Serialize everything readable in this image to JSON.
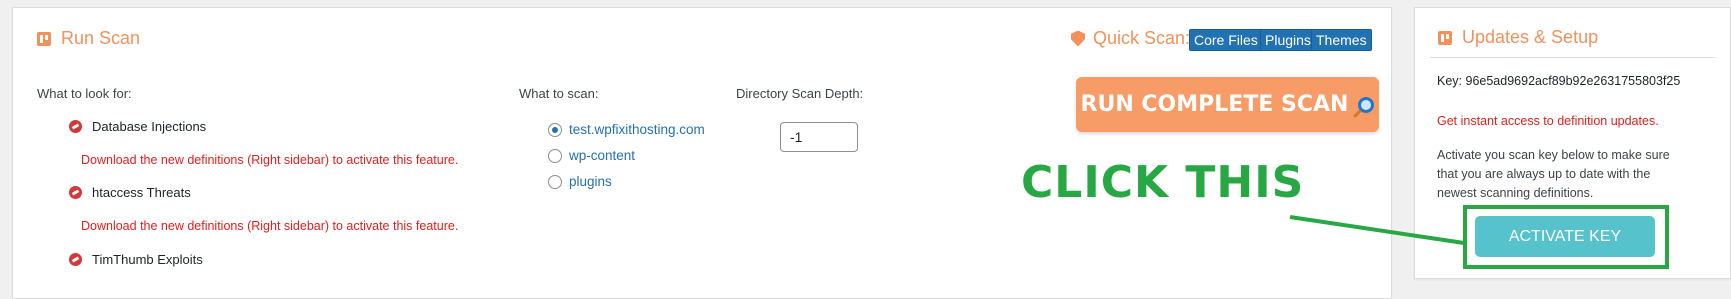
{
  "scan": {
    "title": "Run Scan",
    "quick_scan_label": "Quick Scan:",
    "quick_buttons": [
      "Core Files",
      "Plugins",
      "Themes"
    ],
    "look_for_label": "What to look for:",
    "threats": [
      {
        "name": "Database Injections",
        "warning": "Download the new definitions (Right sidebar) to activate this feature."
      },
      {
        "name": "htaccess Threats",
        "warning": "Download the new definitions (Right sidebar) to activate this feature."
      },
      {
        "name": "TimThumb Exploits"
      }
    ],
    "what_to_scan_label": "What to scan:",
    "scan_targets": [
      {
        "label": "test.wpfixithosting.com",
        "checked": true
      },
      {
        "label": "wp-content",
        "checked": false
      },
      {
        "label": "plugins",
        "checked": false
      }
    ],
    "depth_label": "Directory Scan Depth:",
    "depth_value": "-1",
    "run_button": "RUN COMPLETE SCAN"
  },
  "annotation": {
    "text": "CLICK THIS",
    "color": "#27a844"
  },
  "updates": {
    "title": "Updates & Setup",
    "key_label": "Key:",
    "key_value": "96e5ad9692acf89b92e2631755803f25",
    "red_note": "Get instant access to definition updates.",
    "description": "Activate you scan key below to make sure that you are always up to date with the newest scanning definitions.",
    "activate_button": "ACTIVATE KEY"
  },
  "colors": {
    "accent": "#f2915a",
    "link": "#2271b1",
    "error": "#e0201d",
    "teal": "#56c2cc"
  }
}
